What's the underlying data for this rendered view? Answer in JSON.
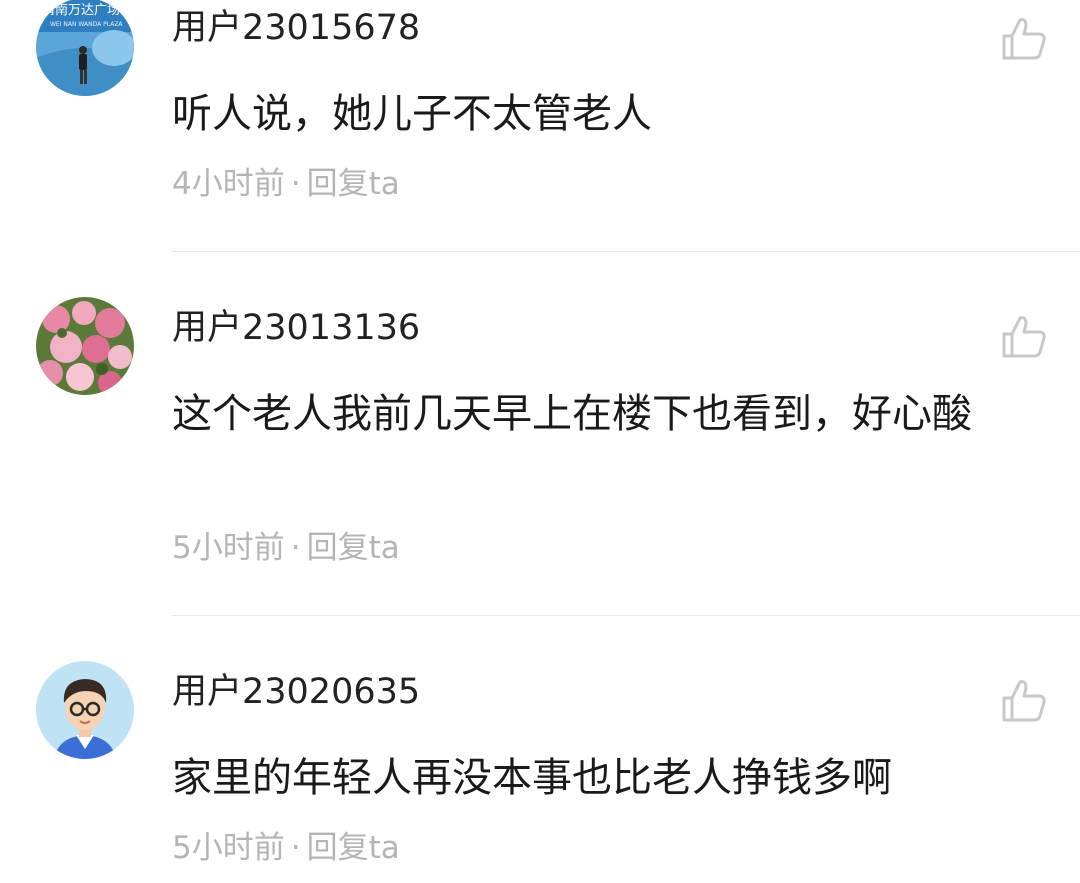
{
  "comments": [
    {
      "username": "用户23015678",
      "content": "听人说，她儿子不太管老人",
      "time": "4小时前",
      "separator": "·",
      "reply_label": "回复ta",
      "avatar": {
        "kind": "photo-banner",
        "banner_text": "渭南万达广场",
        "banner_subtext": "WEI NAN WANDA PLAZA"
      }
    },
    {
      "username": "用户23013136",
      "content": "这个老人我前几天早上在楼下也看到，好心酸",
      "time": "5小时前",
      "separator": "·",
      "reply_label": "回复ta",
      "avatar": {
        "kind": "photo-flowers"
      }
    },
    {
      "username": "用户23020635",
      "content": "家里的年轻人再没本事也比老人挣钱多啊",
      "time": "5小时前",
      "separator": "·",
      "reply_label": "回复ta",
      "avatar": {
        "kind": "cartoon-man-glasses"
      }
    }
  ],
  "colors": {
    "text_primary": "#1a1a1a",
    "text_meta": "#b5b5b5",
    "divider": "#e9e9e9",
    "like_icon": "#c8c8c8"
  }
}
